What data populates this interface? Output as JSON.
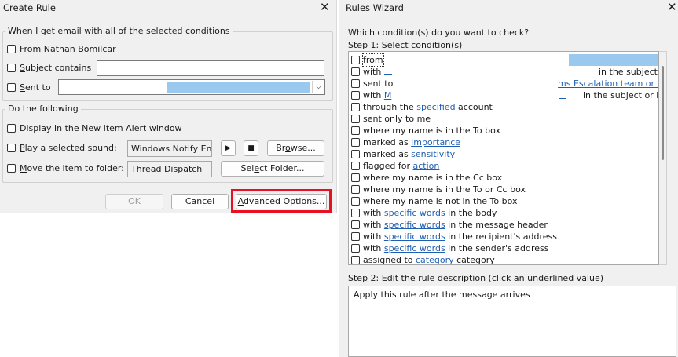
{
  "create_rule": {
    "title": "Create Rule",
    "conditions_group": {
      "legend": "When I get email with all of the selected conditions",
      "from_label": "From Nathan Bomilcar",
      "subject_label": "Subject contains",
      "subject_value": "",
      "sent_to_label": "Sent to",
      "sent_to_value": ""
    },
    "actions_group": {
      "legend": "Do the following",
      "display_label": "Display in the New Item Alert window",
      "play_label": "Play a selected sound:",
      "sound_value": "Windows Notify Em",
      "browse_label": "Browse...",
      "move_label": "Move the item to folder:",
      "folder_value": "Thread Dispatch",
      "select_folder_label": "Select Folder..."
    },
    "buttons": {
      "ok": "OK",
      "cancel": "Cancel",
      "advanced": "Advanced Options..."
    },
    "highlight_color": "#e81123"
  },
  "rules_wizard": {
    "title": "Rules Wizard",
    "question": "Which condition(s) do you want to check?",
    "step1": "Step 1: Select condition(s)",
    "conditions": [
      {
        "pre": "from",
        "link": "",
        "post": ""
      },
      {
        "pre": "with ",
        "link": "",
        "post": "in the subject"
      },
      {
        "pre": "sent to ",
        "link": "ms Escalation team or ...",
        "post": ""
      },
      {
        "pre": "with ",
        "link": "M",
        "post": "in the subject or body"
      },
      {
        "pre": "through the ",
        "link": "specified",
        "post": " account"
      },
      {
        "pre": "sent only to me",
        "link": "",
        "post": ""
      },
      {
        "pre": "where my name is in the To box",
        "link": "",
        "post": ""
      },
      {
        "pre": "marked as ",
        "link": "importance",
        "post": ""
      },
      {
        "pre": "marked as ",
        "link": "sensitivity",
        "post": ""
      },
      {
        "pre": "flagged for ",
        "link": "action",
        "post": ""
      },
      {
        "pre": "where my name is in the Cc box",
        "link": "",
        "post": ""
      },
      {
        "pre": "where my name is in the To or Cc box",
        "link": "",
        "post": ""
      },
      {
        "pre": "where my name is not in the To box",
        "link": "",
        "post": ""
      },
      {
        "pre": "with ",
        "link": "specific words",
        "post": " in the body"
      },
      {
        "pre": "with ",
        "link": "specific words",
        "post": " in the message header"
      },
      {
        "pre": "with ",
        "link": "specific words",
        "post": " in the recipient's address"
      },
      {
        "pre": "with ",
        "link": "specific words",
        "post": " in the sender's address"
      },
      {
        "pre": "assigned to ",
        "link": "category",
        "post": " category"
      }
    ],
    "step2": "Step 2: Edit the rule description (click an underlined value)",
    "description": "Apply this rule after the message arrives",
    "link_color": "#1f5fb2"
  }
}
